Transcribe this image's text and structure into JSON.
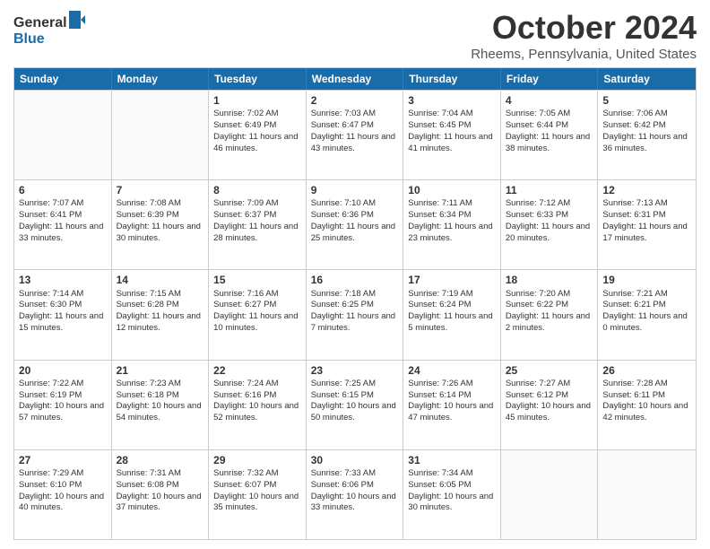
{
  "header": {
    "logo_line1": "General",
    "logo_line2": "Blue",
    "month": "October 2024",
    "location": "Rheems, Pennsylvania, United States"
  },
  "weekdays": [
    "Sunday",
    "Monday",
    "Tuesday",
    "Wednesday",
    "Thursday",
    "Friday",
    "Saturday"
  ],
  "weeks": [
    [
      {
        "day": "",
        "info": ""
      },
      {
        "day": "",
        "info": ""
      },
      {
        "day": "1",
        "info": "Sunrise: 7:02 AM\nSunset: 6:49 PM\nDaylight: 11 hours and 46 minutes."
      },
      {
        "day": "2",
        "info": "Sunrise: 7:03 AM\nSunset: 6:47 PM\nDaylight: 11 hours and 43 minutes."
      },
      {
        "day": "3",
        "info": "Sunrise: 7:04 AM\nSunset: 6:45 PM\nDaylight: 11 hours and 41 minutes."
      },
      {
        "day": "4",
        "info": "Sunrise: 7:05 AM\nSunset: 6:44 PM\nDaylight: 11 hours and 38 minutes."
      },
      {
        "day": "5",
        "info": "Sunrise: 7:06 AM\nSunset: 6:42 PM\nDaylight: 11 hours and 36 minutes."
      }
    ],
    [
      {
        "day": "6",
        "info": "Sunrise: 7:07 AM\nSunset: 6:41 PM\nDaylight: 11 hours and 33 minutes."
      },
      {
        "day": "7",
        "info": "Sunrise: 7:08 AM\nSunset: 6:39 PM\nDaylight: 11 hours and 30 minutes."
      },
      {
        "day": "8",
        "info": "Sunrise: 7:09 AM\nSunset: 6:37 PM\nDaylight: 11 hours and 28 minutes."
      },
      {
        "day": "9",
        "info": "Sunrise: 7:10 AM\nSunset: 6:36 PM\nDaylight: 11 hours and 25 minutes."
      },
      {
        "day": "10",
        "info": "Sunrise: 7:11 AM\nSunset: 6:34 PM\nDaylight: 11 hours and 23 minutes."
      },
      {
        "day": "11",
        "info": "Sunrise: 7:12 AM\nSunset: 6:33 PM\nDaylight: 11 hours and 20 minutes."
      },
      {
        "day": "12",
        "info": "Sunrise: 7:13 AM\nSunset: 6:31 PM\nDaylight: 11 hours and 17 minutes."
      }
    ],
    [
      {
        "day": "13",
        "info": "Sunrise: 7:14 AM\nSunset: 6:30 PM\nDaylight: 11 hours and 15 minutes."
      },
      {
        "day": "14",
        "info": "Sunrise: 7:15 AM\nSunset: 6:28 PM\nDaylight: 11 hours and 12 minutes."
      },
      {
        "day": "15",
        "info": "Sunrise: 7:16 AM\nSunset: 6:27 PM\nDaylight: 11 hours and 10 minutes."
      },
      {
        "day": "16",
        "info": "Sunrise: 7:18 AM\nSunset: 6:25 PM\nDaylight: 11 hours and 7 minutes."
      },
      {
        "day": "17",
        "info": "Sunrise: 7:19 AM\nSunset: 6:24 PM\nDaylight: 11 hours and 5 minutes."
      },
      {
        "day": "18",
        "info": "Sunrise: 7:20 AM\nSunset: 6:22 PM\nDaylight: 11 hours and 2 minutes."
      },
      {
        "day": "19",
        "info": "Sunrise: 7:21 AM\nSunset: 6:21 PM\nDaylight: 11 hours and 0 minutes."
      }
    ],
    [
      {
        "day": "20",
        "info": "Sunrise: 7:22 AM\nSunset: 6:19 PM\nDaylight: 10 hours and 57 minutes."
      },
      {
        "day": "21",
        "info": "Sunrise: 7:23 AM\nSunset: 6:18 PM\nDaylight: 10 hours and 54 minutes."
      },
      {
        "day": "22",
        "info": "Sunrise: 7:24 AM\nSunset: 6:16 PM\nDaylight: 10 hours and 52 minutes."
      },
      {
        "day": "23",
        "info": "Sunrise: 7:25 AM\nSunset: 6:15 PM\nDaylight: 10 hours and 50 minutes."
      },
      {
        "day": "24",
        "info": "Sunrise: 7:26 AM\nSunset: 6:14 PM\nDaylight: 10 hours and 47 minutes."
      },
      {
        "day": "25",
        "info": "Sunrise: 7:27 AM\nSunset: 6:12 PM\nDaylight: 10 hours and 45 minutes."
      },
      {
        "day": "26",
        "info": "Sunrise: 7:28 AM\nSunset: 6:11 PM\nDaylight: 10 hours and 42 minutes."
      }
    ],
    [
      {
        "day": "27",
        "info": "Sunrise: 7:29 AM\nSunset: 6:10 PM\nDaylight: 10 hours and 40 minutes."
      },
      {
        "day": "28",
        "info": "Sunrise: 7:31 AM\nSunset: 6:08 PM\nDaylight: 10 hours and 37 minutes."
      },
      {
        "day": "29",
        "info": "Sunrise: 7:32 AM\nSunset: 6:07 PM\nDaylight: 10 hours and 35 minutes."
      },
      {
        "day": "30",
        "info": "Sunrise: 7:33 AM\nSunset: 6:06 PM\nDaylight: 10 hours and 33 minutes."
      },
      {
        "day": "31",
        "info": "Sunrise: 7:34 AM\nSunset: 6:05 PM\nDaylight: 10 hours and 30 minutes."
      },
      {
        "day": "",
        "info": ""
      },
      {
        "day": "",
        "info": ""
      }
    ]
  ],
  "colors": {
    "header_bg": "#1a6ca8",
    "header_text": "#ffffff",
    "border": "#cccccc",
    "empty_bg": "#f9f9f9"
  }
}
